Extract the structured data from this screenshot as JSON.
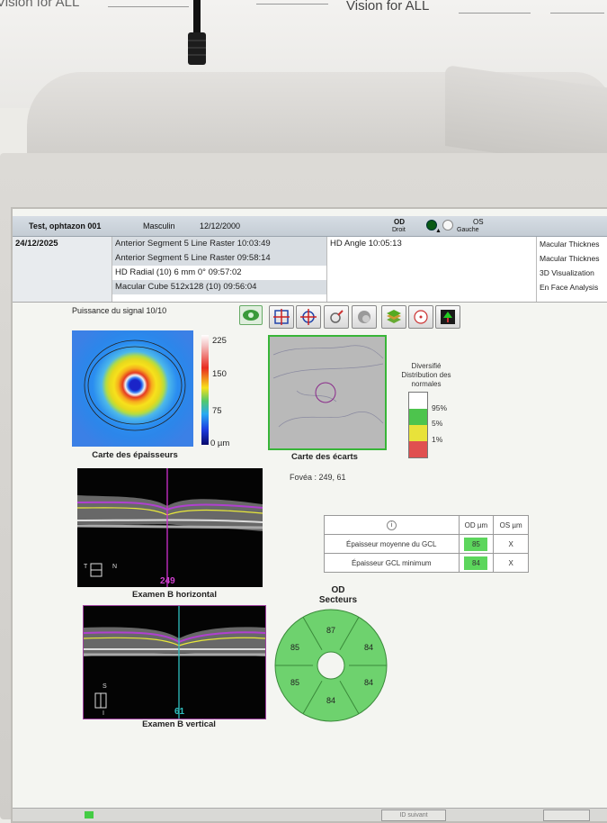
{
  "banner": {
    "text": "Vision for ALL",
    "text_left": "Vision for ALL"
  },
  "patient": {
    "name": "Test, ophtazon 001",
    "sex": "Masculin",
    "dob": "12/12/2000",
    "eye_od": "OD",
    "eye_od_sub": "Droit",
    "eye_os": "OS",
    "eye_os_sub": "Gauche"
  },
  "exams": {
    "date": "24/12/2025",
    "list": [
      "Anterior Segment 5 Line Raster 10:03:49",
      "Anterior Segment 5 Line Raster 09:58:14",
      "HD Radial (10) 6 mm 0° 09:57:02",
      "Macular Cube 512x128 (10) 09:56:04"
    ],
    "other": "HD Angle 10:05:13",
    "analyses": [
      "Macular Thicknes",
      "Macular Thicknes",
      "3D Visualization",
      "En Face Analysis"
    ]
  },
  "toolbar": {
    "signal": "Puissance du signal  10/10",
    "icons": [
      "eye-toggle-icon",
      "crosshair-grid-icon",
      "crosshair-target-icon",
      "pin-icon",
      "gray-circle-icon",
      "layers-3d-icon",
      "fovea-circle-icon",
      "tree-map-icon"
    ]
  },
  "thickness_map": {
    "label": "Carte des épaisseurs",
    "scale": {
      "max": "225",
      "mid": "150",
      "low": "75",
      "min": "0 µm"
    }
  },
  "deviation_map": {
    "label": "Carte des écarts",
    "legend_title": "Diversifié Distribution des normales",
    "legend": [
      "95%",
      "5%",
      "1%"
    ],
    "legend_colors": [
      "#ffffff",
      "#4dc44d",
      "#e8e23a",
      "#e05050"
    ]
  },
  "fovea": "Fovéa :  249, 61",
  "bscan_h": {
    "label": "Examen B horizontal",
    "index": "249",
    "dir_left": "T",
    "dir_right": "N"
  },
  "bscan_v": {
    "label": "Examen B vertical",
    "index": "61",
    "dir_top": "S",
    "dir_bottom": "I"
  },
  "gcl_table": {
    "col_od": "OD µm",
    "col_os": "OS µm",
    "rows": [
      {
        "label": "Épaisseur moyenne du GCL",
        "od": "85",
        "os": "X"
      },
      {
        "label": "Épaisseur GCL minimum",
        "od": "84",
        "os": "X"
      }
    ]
  },
  "sectors": {
    "title": "OD",
    "subtitle": "Secteurs",
    "values": {
      "top": "87",
      "upper_right": "84",
      "lower_right": "84",
      "bottom": "84",
      "lower_left": "85",
      "upper_left": "85"
    }
  },
  "taskbar": {
    "button": "ID suivant"
  }
}
